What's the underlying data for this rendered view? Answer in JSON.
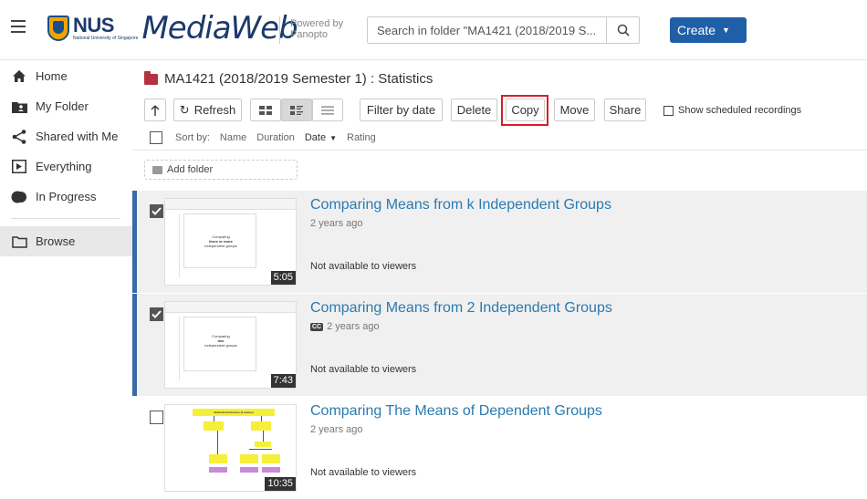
{
  "header": {
    "logo_text": "NUS",
    "logo_sub": "National University of Singapore",
    "app_name": "MediaWeb",
    "powered_line1": "Powered by",
    "powered_line2": "Panopto",
    "search_placeholder": "Search in folder \"MA1421 (2018/2019 S...",
    "create_label": "Create"
  },
  "sidebar": {
    "items": [
      {
        "label": "Home",
        "icon": "home-icon"
      },
      {
        "label": "My Folder",
        "icon": "user-folder-icon"
      },
      {
        "label": "Shared with Me",
        "icon": "share-icon"
      },
      {
        "label": "Everything",
        "icon": "play-icon"
      },
      {
        "label": "In Progress",
        "icon": "progress-icon"
      },
      {
        "label": "Browse",
        "icon": "folder-outline-icon"
      }
    ]
  },
  "folder": {
    "title": "MA1421 (2018/2019 Semester 1) : Statistics"
  },
  "toolbar": {
    "refresh": "Refresh",
    "filter": "Filter by date",
    "delete": "Delete",
    "copy": "Copy",
    "move": "Move",
    "share": "Share",
    "scheduled": "Show scheduled recordings"
  },
  "sort": {
    "label": "Sort by:",
    "name": "Name",
    "duration": "Duration",
    "date": "Date",
    "rating": "Rating"
  },
  "add_folder": "Add folder",
  "sessions": [
    {
      "title": "Comparing Means from k Independent Groups",
      "meta": "2 years ago",
      "availability": "Not available to viewers",
      "duration": "5:05",
      "selected": true,
      "slide_text": [
        "Comparing",
        "three or more",
        "independent groups"
      ]
    },
    {
      "title": "Comparing Means from 2 Independent Groups",
      "meta": "2 years ago",
      "cc": "CC",
      "availability": "Not available to viewers",
      "duration": "7:43",
      "selected": true,
      "slide_text": [
        "Comparing",
        "two",
        "independent groups"
      ]
    },
    {
      "title": "Comparing The Means of Dependent Groups",
      "meta": "2 years ago",
      "availability": "Not available to viewers",
      "duration": "10:35",
      "selected": false,
      "slide_text": [
        "Statistical Inference (2 means)"
      ]
    }
  ],
  "colors": {
    "brand_blue": "#1f5fa8",
    "link": "#2a7ab0",
    "highlight": "#d81e2a",
    "folder": "#b33240"
  }
}
